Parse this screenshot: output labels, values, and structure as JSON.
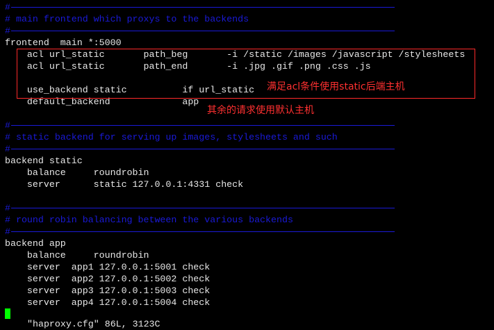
{
  "terminal": {
    "lines": [
      {
        "type": "rule",
        "text": "#"
      },
      {
        "type": "comment",
        "text": "# main frontend which proxys to the backends"
      },
      {
        "type": "rule",
        "text": "#"
      },
      {
        "type": "code",
        "text": "frontend  main *:5000"
      },
      {
        "type": "code",
        "text": "    acl url_static       path_beg       -i /static /images /javascript /stylesheets"
      },
      {
        "type": "code",
        "text": "    acl url_static       path_end       -i .jpg .gif .png .css .js"
      },
      {
        "type": "code",
        "text": ""
      },
      {
        "type": "code",
        "text": "    use_backend static          if url_static"
      },
      {
        "type": "code",
        "text": "    default_backend             app"
      },
      {
        "type": "code",
        "text": ""
      },
      {
        "type": "rule",
        "text": "#"
      },
      {
        "type": "comment",
        "text": "# static backend for serving up images, stylesheets and such"
      },
      {
        "type": "rule",
        "text": "#"
      },
      {
        "type": "code",
        "text": "backend static"
      },
      {
        "type": "code",
        "text": "    balance     roundrobin"
      },
      {
        "type": "code",
        "text": "    server      static 127.0.0.1:4331 check"
      },
      {
        "type": "code",
        "text": ""
      },
      {
        "type": "rule",
        "text": "#"
      },
      {
        "type": "comment",
        "text": "# round robin balancing between the various backends"
      },
      {
        "type": "rule",
        "text": "#"
      },
      {
        "type": "code",
        "text": "backend app"
      },
      {
        "type": "code",
        "text": "    balance     roundrobin"
      },
      {
        "type": "code",
        "text": "    server  app1 127.0.0.1:5001 check"
      },
      {
        "type": "code",
        "text": "    server  app2 127.0.0.1:5002 check"
      },
      {
        "type": "code",
        "text": "    server  app3 127.0.0.1:5003 check"
      },
      {
        "type": "code",
        "text": "    server  app4 127.0.0.1:5004 check"
      }
    ],
    "partial_line": "\"haproxy.cfg\" 86L, 3123C"
  },
  "annotations": {
    "note1": "满足acl条件使用static后端主机",
    "note2": "其余的请求使用默认主机"
  },
  "colors": {
    "comment": "#1a1ad8",
    "annotation": "#ff3030",
    "cursor": "#00ff00"
  }
}
